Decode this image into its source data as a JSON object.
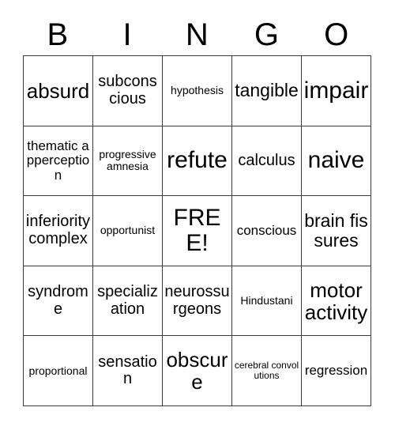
{
  "card": {
    "title": "BINGO",
    "columns": [
      "B",
      "I",
      "N",
      "G",
      "O"
    ],
    "free_space": "FREE!",
    "grid_size": "5x5",
    "border_color": "#3a3a3a",
    "background_color": "#ffffff",
    "text_color": "#000000",
    "rows": [
      [
        {
          "text": "absurd",
          "size": "xl"
        },
        {
          "text": "subconscious",
          "size": "md"
        },
        {
          "text": "hypothesis",
          "size": "xs"
        },
        {
          "text": "tangible",
          "size": "lg"
        },
        {
          "text": "impair",
          "size": "xxl"
        }
      ],
      [
        {
          "text": "thematic apperception",
          "size": "sm"
        },
        {
          "text": "progressive amnesia",
          "size": "xs"
        },
        {
          "text": "refute",
          "size": "xxl"
        },
        {
          "text": "calculus",
          "size": "md"
        },
        {
          "text": "naive",
          "size": "xxl"
        }
      ],
      [
        {
          "text": "inferiority complex",
          "size": "md"
        },
        {
          "text": "opportunist",
          "size": "xs"
        },
        {
          "text": "FREE!",
          "size": "xxl"
        },
        {
          "text": "conscious",
          "size": "sm"
        },
        {
          "text": "brain fissures",
          "size": "lg"
        }
      ],
      [
        {
          "text": "syndrome",
          "size": "md"
        },
        {
          "text": "specialization",
          "size": "md"
        },
        {
          "text": "neurossurgeons",
          "size": "md"
        },
        {
          "text": "Hindustani",
          "size": "xs"
        },
        {
          "text": "motor activity",
          "size": "xl"
        }
      ],
      [
        {
          "text": "proportional",
          "size": "xs"
        },
        {
          "text": "sensation",
          "size": "md"
        },
        {
          "text": "obscure",
          "size": "xl"
        },
        {
          "text": "cerebral convolutions",
          "size": "xxs"
        },
        {
          "text": "regression",
          "size": "sm"
        }
      ]
    ]
  }
}
